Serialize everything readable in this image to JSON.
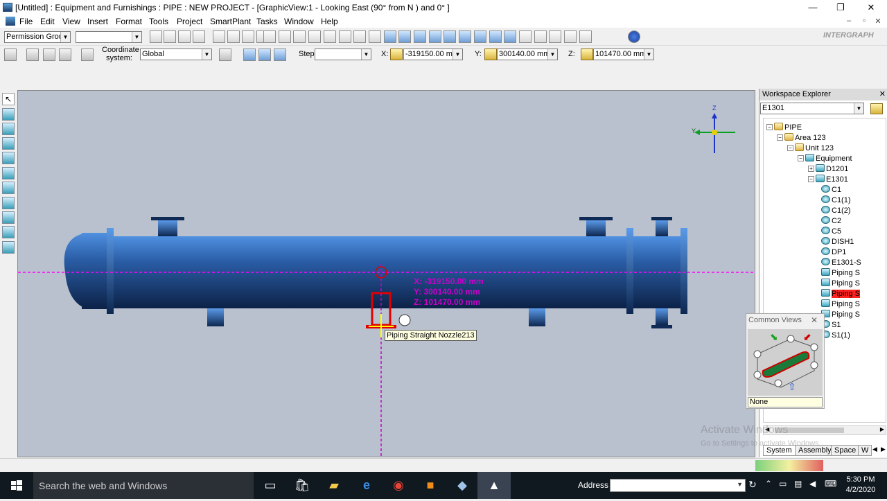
{
  "window": {
    "title": "[Untitled] : Equipment and Furnishings : PIPE : NEW PROJECT - [GraphicView:1 - Looking East (90° from N ) and 0° ]",
    "minimize": "—",
    "restore": "❐",
    "close": "✕"
  },
  "menu": {
    "items": [
      "File",
      "Edit",
      "View",
      "Insert",
      "Format",
      "Tools",
      "Project",
      "SmartPlant",
      "Tasks",
      "Window",
      "Help"
    ],
    "mdi_min": "–",
    "mdi_restore": "▫",
    "mdi_close": "✕"
  },
  "toolbar1": {
    "permission_group": "Permission Group",
    "second_combo": "",
    "brand": "INTERGRAPH"
  },
  "toolbar2": {
    "coordinate_label": "Coordinate system:",
    "coordinate_line1": "Coordinate",
    "coordinate_line2": "system:",
    "coordinate_value": "Global",
    "step_label": "Step:",
    "step_value": "",
    "x_label": "X:",
    "x_value": "-319150.00 mm",
    "y_label": "Y:",
    "y_value": "300140.00 mm",
    "z_label": "Z:",
    "z_value": "101470.00 mm"
  },
  "graphic_view": {
    "readout_x": "X: -319150.00 mm",
    "readout_y": "Y: 300140.00 mm",
    "readout_z": "Z: 101470.00 mm",
    "tooltip": "Piping Straight Nozzle213",
    "axis_z": "Z",
    "axis_y": "Y"
  },
  "workspace_explorer": {
    "title": "Workspace Explorer",
    "filter_value": "E1301",
    "tree": [
      {
        "label": "PIPE",
        "level": 0,
        "icon": "folder",
        "exp": "−"
      },
      {
        "label": "Area 123",
        "level": 1,
        "icon": "folder",
        "exp": "−"
      },
      {
        "label": "Unit 123",
        "level": 2,
        "icon": "folder",
        "exp": "−"
      },
      {
        "label": "Equipment",
        "level": 3,
        "icon": "equip",
        "exp": "−"
      },
      {
        "label": "D1201",
        "level": 4,
        "icon": "equip",
        "exp": "+"
      },
      {
        "label": "E1301",
        "level": 4,
        "icon": "equip",
        "exp": "−"
      },
      {
        "label": "C1",
        "level": 5,
        "icon": "round",
        "exp": ""
      },
      {
        "label": "C1(1)",
        "level": 5,
        "icon": "round",
        "exp": ""
      },
      {
        "label": "C1(2)",
        "level": 5,
        "icon": "round",
        "exp": ""
      },
      {
        "label": "C2",
        "level": 5,
        "icon": "round",
        "exp": ""
      },
      {
        "label": "C5",
        "level": 5,
        "icon": "round",
        "exp": ""
      },
      {
        "label": "DISH1",
        "level": 5,
        "icon": "round",
        "exp": ""
      },
      {
        "label": "DP1",
        "level": 5,
        "icon": "round",
        "exp": ""
      },
      {
        "label": "E1301-S",
        "level": 5,
        "icon": "round",
        "exp": ""
      },
      {
        "label": "Piping S",
        "level": 5,
        "icon": "nozzle",
        "exp": ""
      },
      {
        "label": "Piping S",
        "level": 5,
        "icon": "nozzle",
        "exp": ""
      },
      {
        "label": "Piping S",
        "level": 5,
        "icon": "nozzle",
        "exp": "",
        "selected": true
      },
      {
        "label": "Piping S",
        "level": 5,
        "icon": "nozzle",
        "exp": ""
      },
      {
        "label": "Piping S",
        "level": 5,
        "icon": "nozzle",
        "exp": ""
      },
      {
        "label": "S1",
        "level": 5,
        "icon": "round",
        "exp": ""
      },
      {
        "label": "S1(1)",
        "level": 5,
        "icon": "round",
        "exp": ""
      }
    ],
    "tabs": [
      "System",
      "Assembly",
      "Space",
      "W"
    ],
    "watermark_line1": "Activate Windows",
    "watermark_line2": "Go to Settings to activate Windows."
  },
  "common_views": {
    "title": "Common Views",
    "close": "✕",
    "value": "None"
  },
  "taskbar": {
    "search_placeholder": "Search the web and Windows",
    "address_label": "Address",
    "time": "5:30 PM",
    "date": "4/2/2020"
  },
  "colors": {
    "vessel": "#1f4f8f",
    "selection": "#e00000",
    "readout": "#cc00cc",
    "highlight": "#ff2020"
  }
}
